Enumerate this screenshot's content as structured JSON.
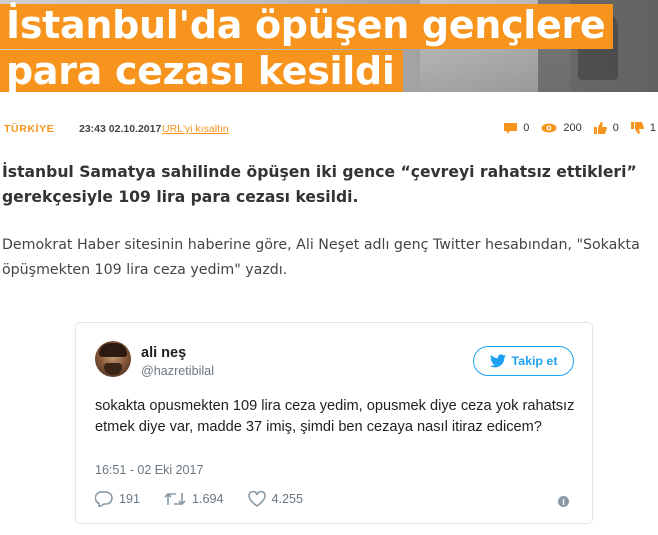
{
  "hero": {
    "line1": "İstanbul'da öpüşen gençlere",
    "line2": "para cezası kesildi"
  },
  "meta": {
    "category": "TÜRKİYE",
    "timestamp": "23:43 02.10.2017",
    "shorten_label": "URL'yi kısaltın",
    "stats": [
      {
        "icon": "comment-icon",
        "value": "0"
      },
      {
        "icon": "views-icon",
        "value": "200"
      },
      {
        "icon": "like-icon",
        "value": "0"
      },
      {
        "icon": "dislike-icon",
        "value": "1"
      }
    ]
  },
  "article": {
    "lead": "İstanbul Samatya sahilinde öpüşen iki gence “çevreyi rahatsız ettikleri” gerekçesiyle 109 lira para cezası kesildi.",
    "paragraph": "Demokrat Haber sitesinin haberine göre, Ali Neşet adlı genç Twitter hesabından, \"Sokakta öpüşmekten 109 lira ceza yedim\" yazdı."
  },
  "tweet": {
    "name": "ali neş",
    "handle": "@hazretibilal",
    "follow_label": "Takip et",
    "text": "sokakta opusmekten 109 lira ceza yedim, opusmek diye ceza yok rahatsız etmek diye var, madde 37 imiş, şimdi ben cezaya nasıl itiraz edicem?",
    "date": "16:51 - 02 Eki 2017",
    "replies": "191",
    "retweets": "1.694",
    "likes": "4.255"
  },
  "colors": {
    "accent": "#f7941d",
    "twitter_blue": "#1da1f2",
    "muted": "#697882"
  }
}
